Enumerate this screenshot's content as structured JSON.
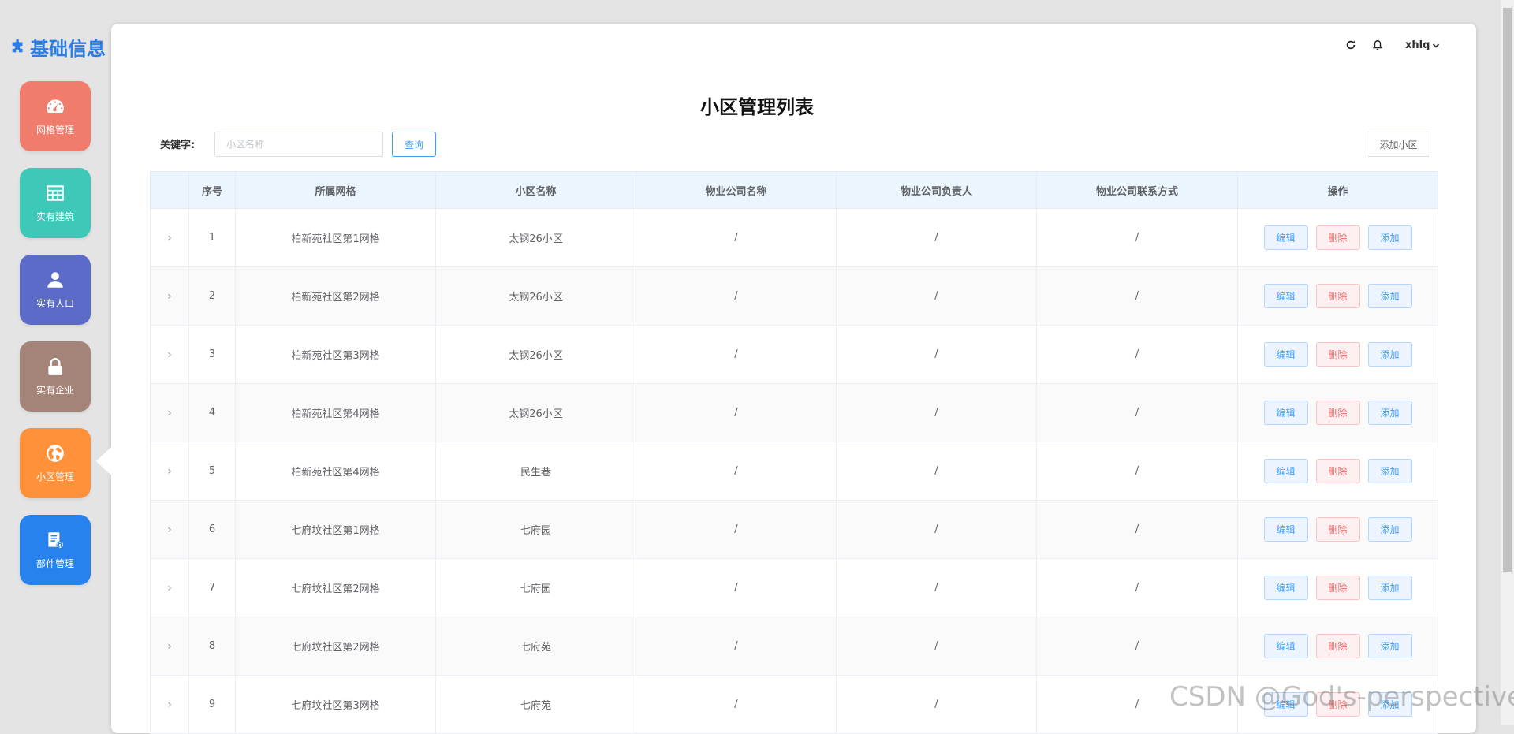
{
  "sidebar": {
    "brand": "基础信息",
    "items": [
      {
        "label": "网格管理",
        "icon": "dashboard-icon",
        "color": "#f07c6c"
      },
      {
        "label": "实有建筑",
        "icon": "table-grid-icon",
        "color": "#3dc8b8"
      },
      {
        "label": "实有人口",
        "icon": "person-icon",
        "color": "#5c6bc7"
      },
      {
        "label": "实有企业",
        "icon": "lock-icon",
        "color": "#a48479"
      },
      {
        "label": "小区管理",
        "icon": "globe-icon",
        "color": "#ff913b",
        "active": true
      },
      {
        "label": "部件管理",
        "icon": "document-gear-icon",
        "color": "#2782ed"
      }
    ]
  },
  "topbar": {
    "refresh_icon": "refresh-icon",
    "bell_icon": "bell-icon",
    "user_name": "xhlq"
  },
  "page": {
    "title": "小区管理列表",
    "keyword_label": "关键字:",
    "search_placeholder": "小区名称",
    "search_value": "",
    "query_button": "查询",
    "add_community_button": "添加小区"
  },
  "table": {
    "columns": [
      "",
      "序号",
      "所属网格",
      "小区名称",
      "物业公司名称",
      "物业公司负责人",
      "物业公司联系方式",
      "操作"
    ],
    "actions": {
      "edit": "编辑",
      "delete": "删除",
      "add": "添加"
    },
    "rows": [
      {
        "no": "1",
        "grid": "柏新苑社区第1网格",
        "name": "太钢26小区",
        "company": "/",
        "manager": "/",
        "contact": "/"
      },
      {
        "no": "2",
        "grid": "柏新苑社区第2网格",
        "name": "太钢26小区",
        "company": "/",
        "manager": "/",
        "contact": "/"
      },
      {
        "no": "3",
        "grid": "柏新苑社区第3网格",
        "name": "太钢26小区",
        "company": "/",
        "manager": "/",
        "contact": "/"
      },
      {
        "no": "4",
        "grid": "柏新苑社区第4网格",
        "name": "太钢26小区",
        "company": "/",
        "manager": "/",
        "contact": "/"
      },
      {
        "no": "5",
        "grid": "柏新苑社区第4网格",
        "name": "民生巷",
        "company": "/",
        "manager": "/",
        "contact": "/"
      },
      {
        "no": "6",
        "grid": "七府坟社区第1网格",
        "name": "七府园",
        "company": "/",
        "manager": "/",
        "contact": "/"
      },
      {
        "no": "7",
        "grid": "七府坟社区第2网格",
        "name": "七府园",
        "company": "/",
        "manager": "/",
        "contact": "/"
      },
      {
        "no": "8",
        "grid": "七府坟社区第2网格",
        "name": "七府苑",
        "company": "/",
        "manager": "/",
        "contact": "/"
      },
      {
        "no": "9",
        "grid": "七府坟社区第3网格",
        "name": "七府苑",
        "company": "/",
        "manager": "/",
        "contact": "/"
      }
    ]
  },
  "watermark": "CSDN @God's-perspective"
}
